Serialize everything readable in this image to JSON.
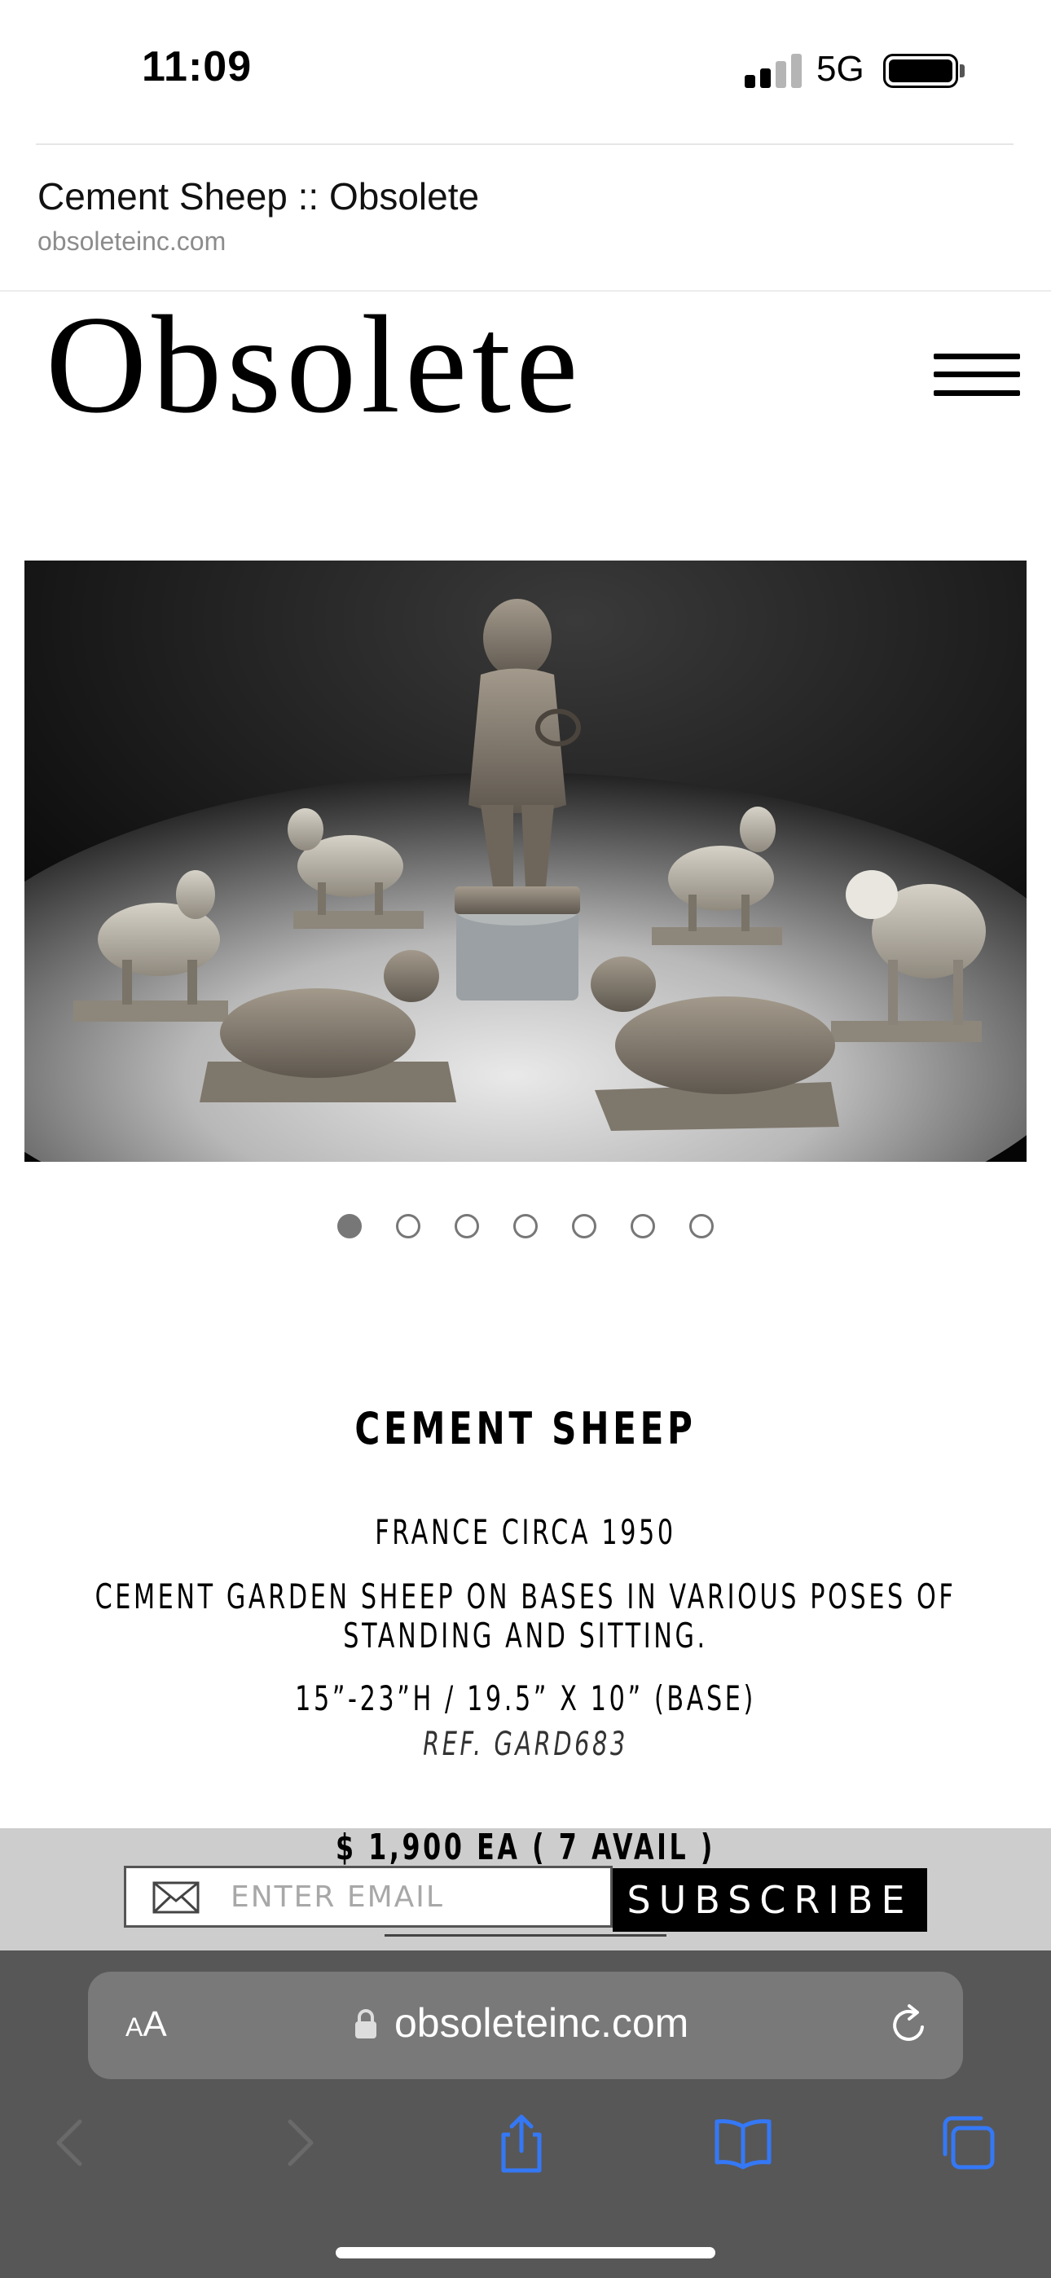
{
  "status_bar": {
    "time": "11:09",
    "network": "5G",
    "signal_bars": 2,
    "signal_bars_total": 4,
    "battery_level": 1.0
  },
  "page_header": {
    "title": "Cement Sheep :: Obsolete",
    "domain": "obsoleteinc.com"
  },
  "site": {
    "logo": "Obsolete",
    "menu_icon": "hamburger-menu-icon"
  },
  "gallery": {
    "image_alt": "Cement garden sheep on bases surrounding a cherub statue",
    "slide_count": 7,
    "active_slide": 1
  },
  "product": {
    "title": "CEMENT SHEEP",
    "origin": "FRANCE CIRCA 1950",
    "description": "CEMENT GARDEN SHEEP ON BASES IN VARIOUS POSES OF STANDING AND SITTING.",
    "dimensions": "15”-23”H / 19.5” X 10” (BASE)",
    "reference": "REF. GARD683",
    "price": "$ 1,900 EA ( 7 AVAIL )"
  },
  "newsletter": {
    "placeholder": "ENTER EMAIL",
    "button_label": "SUBSCRIBE",
    "icon": "mail-icon"
  },
  "browser": {
    "text_size_label_small": "A",
    "text_size_label_large": "A",
    "url": "obsoleteinc.com",
    "icons": [
      "back-icon",
      "forward-icon",
      "share-icon",
      "bookmarks-icon",
      "tabs-icon",
      "reload-icon",
      "lock-icon"
    ]
  },
  "colors": {
    "accent_blue": "#3478f6",
    "toolbar_bg": "#575757",
    "subscribe_bg": "#000000"
  }
}
